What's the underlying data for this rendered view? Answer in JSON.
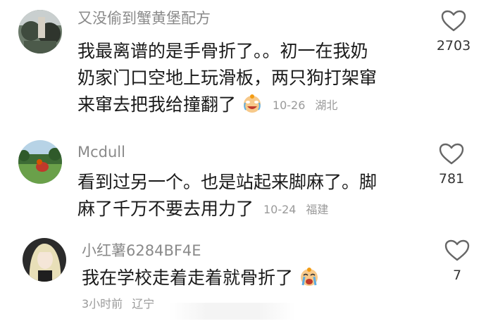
{
  "comments": [
    {
      "username": "又没偷到蟹黄堡配方",
      "lines": [
        "我最离谱的是手骨折了。。初一在我奶",
        "奶家门口空地上玩滑板，两只狗打架窜",
        "来窜去把我给撞翻了"
      ],
      "emoji_icon": "crying-laughing-face-icon",
      "date": "10-26",
      "location": "湖北",
      "likes": "2703"
    },
    {
      "username": "Mcdull",
      "lines": [
        "看到过另一个。也是站起来脚麻了。脚",
        "麻了千万不要去用力了"
      ],
      "date": "10-24",
      "location": "福建",
      "likes": "781"
    },
    {
      "username": "小红薯6284BF4E",
      "lines": [
        "我在学校走着走着就骨折了"
      ],
      "emoji_icon": "crying-face-icon",
      "date": "3小时前",
      "location": "辽宁",
      "likes": "7"
    }
  ],
  "icons": {
    "like": "heart-outline-icon"
  },
  "colors": {
    "username": "#8a8a8a",
    "text": "#1a1a1a",
    "meta": "#9a9a9a",
    "heart": "#666666"
  }
}
